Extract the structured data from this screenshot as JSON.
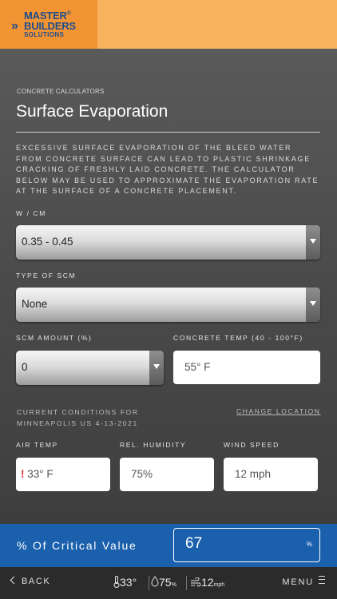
{
  "brand": {
    "logo_line1": "MASTER",
    "logo_line2": "BUILDERS",
    "logo_line3": "SOLUTIONS",
    "colors": {
      "header": "#f8b35c",
      "logo_bg": "#f29433",
      "result_band": "#1a60ac"
    }
  },
  "page": {
    "breadcrumb": "CONCRETE CALCULATORS",
    "title": "Surface Evaporation",
    "description": "EXCESSIVE SURFACE EVAPORATION OF THE BLEED WATER FROM CONCRETE SURFACE CAN LEAD TO PLASTIC SHRINKAGE CRACKING OF FRESHLY LAID CONCRETE. THE CALCULATOR BELOW MAY BE USED TO APPROXIMATE THE EVAPORATION RATE AT THE SURFACE OF A CONCRETE PLACEMENT."
  },
  "form": {
    "wcm": {
      "label": "W / CM",
      "value": "0.35 - 0.45"
    },
    "scm_type": {
      "label": "TYPE OF SCM",
      "value": "None"
    },
    "scm_amount": {
      "label": "SCM AMOUNT (%)",
      "value": "0"
    },
    "concrete_temp": {
      "label": "CONCRETE TEMP (40 - 100°F)",
      "value": "55° F"
    }
  },
  "conditions": {
    "line1": "CURRENT CONDITIONS FOR",
    "line2": "MINNEAPOLIS US 4-13-2021",
    "change_location": "CHANGE LOCATION",
    "air_temp": {
      "label": "AIR TEMP",
      "warning": "!",
      "value": "33° F"
    },
    "humidity": {
      "label": "REL. HUMIDITY",
      "value": "75%"
    },
    "wind_speed": {
      "label": "WIND SPEED",
      "value": "12 mph"
    }
  },
  "result": {
    "label": "% Of Critical Value",
    "value": "67",
    "unit": "%"
  },
  "bottom_bar": {
    "back": "BACK",
    "temp": "33°",
    "humidity": "75",
    "humidity_unit": "%",
    "wind": "12",
    "wind_unit": "mph",
    "menu": "MENU",
    "icons": [
      "thermometer-icon",
      "droplet-icon",
      "wind-icon",
      "hamburger-icon"
    ]
  }
}
